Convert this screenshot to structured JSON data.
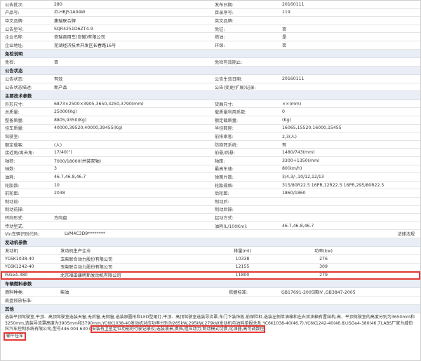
{
  "pairs1": [
    [
      "公告批次:",
      "280",
      "发布日期:",
      "20160111"
    ],
    [
      "产品号:",
      "ZLHBJ51A04W",
      "目录序号:",
      "119"
    ],
    [
      "中文品牌:",
      "集瑞联合牌",
      "英文品牌:",
      ""
    ],
    [
      "公告型号:",
      "SQR4251D6ZT4-9",
      "免征:",
      "否"
    ],
    [
      "企业名称:",
      "奇瑞商用车(安徽)有限公司",
      "燃油:",
      "是"
    ],
    [
      "企业地址:",
      "芜湖经济技术开发区长春路16号",
      "环保:",
      "否"
    ]
  ],
  "sec_exempt": "免检说明",
  "pairs2": [
    [
      "免检:",
      "否",
      "免检有效期止:",
      ""
    ]
  ],
  "sec_status": "公告状态",
  "pairs3": [
    [
      "公告状态:",
      "有效",
      "公告生效日期:",
      "20160111"
    ],
    [
      "公告状态描述:",
      "新产品",
      "公告(变更/扩展)记录:",
      ""
    ]
  ],
  "sec_tech": "主要技术参数",
  "pairs4": [
    [
      "外形尺寸:",
      "6873×2500×3905,3650,3250,3790(mm)",
      "货厢尺寸:",
      "××(mm)"
    ],
    [
      "总质量:",
      "25000(Kg)",
      "载质量利用系数:",
      "0"
    ],
    [
      "整备质量:",
      "8805,9350(Kg)",
      "额定载质量:",
      "(Kg)"
    ],
    [
      "挂车质量:",
      "40000,39520,40000,39455(Kg)",
      "半挂鞍座:",
      "16065,15520,16000,15455"
    ],
    [
      "驾驶室:",
      "",
      "前排乘客:",
      "2,3(人)"
    ],
    [
      "额定载客:",
      "(人)",
      "防抱死系统:",
      "有"
    ],
    [
      "接近角/离去角:",
      "17/40(°)",
      "前悬/后悬:",
      "1480/743(mm)"
    ],
    [
      "轴荷:",
      "7000/18000(并装双轴)",
      "轴距:",
      "3300+1350(mm)"
    ],
    [
      "轴数:",
      "3",
      "最高车速:",
      "80(km/h)"
    ],
    [
      "油耗:",
      "46.7,46.8,46.7",
      "弹簧片数:",
      "3/4,3/-,10/12,12/13"
    ],
    [
      "轮胎数:",
      "10",
      "轮胎规格:",
      "315/80R22.5 16PR,12R22.5 16PR,295/80R22.5"
    ],
    [
      "前轮距:",
      "2038",
      "后轮距:",
      "1860/1860"
    ],
    [
      "制动前:",
      "",
      "制动后:",
      ""
    ],
    [
      "制动前操:",
      "",
      "制动后操:",
      ""
    ],
    [
      "转向形式:",
      "方向盘",
      "起动方式:",
      ""
    ],
    [
      "传动型式:",
      "",
      "油耗(L/100Km):",
      "46.7,46.8,46.7"
    ]
  ],
  "vin_label": "Vin车辆识别代码:",
  "vin_value": "LVM4C3D9********",
  "vin_right": "法律法规",
  "sec_engine": "发动机参数",
  "engine_head": [
    "发动机",
    "发动机生产企业",
    "排量(ml)",
    "功率(kw)"
  ],
  "engine_rows": [
    [
      "YC6K1038-40",
      "玉柴联合动力股份有限公司",
      "10338",
      "276"
    ],
    [
      "YC6K1242-40",
      "玉柴联合动力股份有限公司",
      "12155",
      "309"
    ],
    [
      "ISGe4-380",
      "北京福田康明斯发动机有限公司",
      "11800",
      "279"
    ]
  ],
  "sec_fuel": "车辆燃料参数",
  "fuel_row": [
    "燃料种类:",
    "柴油",
    "依据标准:",
    "GB17691-2005国IV ,GB3847-2005"
  ],
  "sec_other": "其他",
  "notes_main": "选装平顶驾驶室,平顶、高顶驾驶室选装天窗,无后窗,无侧窗,选装原圆形和LED型尾灯,平顶、高顶驾驶室选装导流罩,车门下装饰板,前保险杠,选装左侧单油箱和左右双油箱有置结构,高、平顶驾驶室的高度分别为3650mm和3250mm,选装导流罩高度为3905mm和3790mm,YC6K1038-40发动机对应功率分别为265kW,295kW,279kW发动机与油耗单报关系:YC6K1038-40(46.7),YC6K1242-40(46.8),ISGe4-380(46.7),ABS厂家为威伯科汽车控制系统有限公司,型号446 004 630 0",
  "notes_marked": "安装有卫星定位功能的行驶记录仪;选装液景,换挡,阻压动力,制动模式切换,化油器,高可调数控",
  "notes_tail": "输牛挂车"
}
